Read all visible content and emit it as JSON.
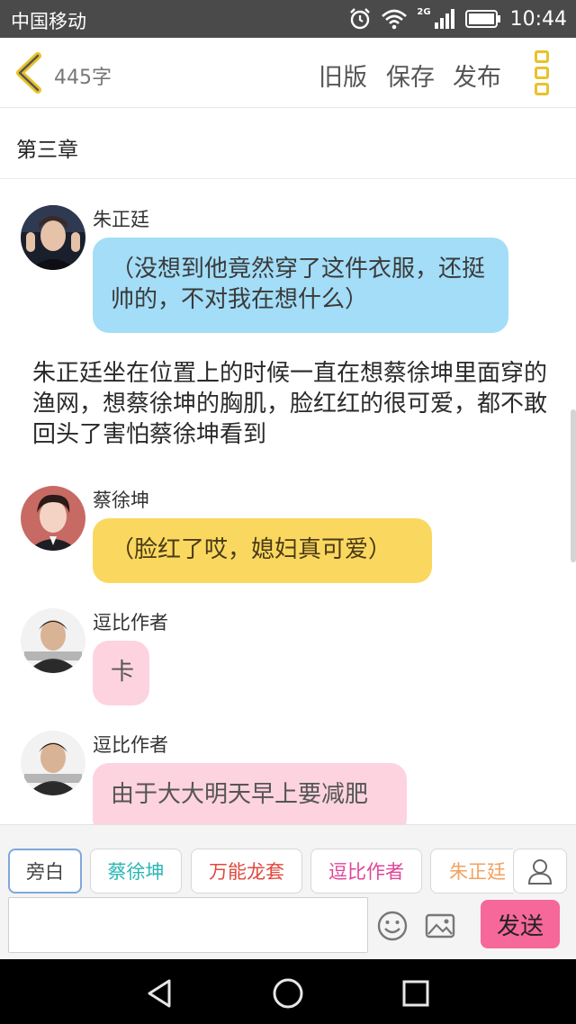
{
  "status_bar": {
    "carrier": "中国移动",
    "network": "2G",
    "time": "10:44"
  },
  "toolbar": {
    "word_count": "445字",
    "old_version": "旧版",
    "save": "保存",
    "publish": "发布"
  },
  "chapter": {
    "title": "第三章"
  },
  "messages": [
    {
      "speaker": "朱正廷",
      "text": "（没想到他竟然穿了这件衣服，还挺帅的，不对我在想什么）",
      "color": "#a3ddf7"
    },
    {
      "narration": "朱正廷坐在位置上的时候一直在想蔡徐坤里面穿的渔网，想蔡徐坤的胸肌，脸红红的很可爱，都不敢回头了害怕蔡徐坤看到"
    },
    {
      "speaker": "蔡徐坤",
      "text": "（脸红了哎，媳妇真可爱）",
      "color": "#fad85f"
    },
    {
      "speaker": "逗比作者",
      "text": "卡",
      "color": "#fcd3df"
    },
    {
      "speaker": "逗比作者",
      "text": "由于大大明天早上要减肥",
      "color": "#fcd3df"
    }
  ],
  "roles": [
    {
      "label": "旁白",
      "color": "#444444",
      "active": true
    },
    {
      "label": "蔡徐坤",
      "color": "#2bb5b5"
    },
    {
      "label": "万能龙套",
      "color": "#e0483e"
    },
    {
      "label": "逗比作者",
      "color": "#e0459a"
    },
    {
      "label": "朱正廷",
      "color": "#f2a260"
    }
  ],
  "input": {
    "value": "",
    "send_label": "发送"
  },
  "colors": {
    "accent_yellow": "#e8c229",
    "send_pink": "#f6679a"
  },
  "icons": [
    "back-chevron-icon",
    "more-menu-icon",
    "user-icon",
    "emoji-icon",
    "image-icon",
    "nav-back-icon",
    "nav-home-icon",
    "nav-recent-icon"
  ]
}
